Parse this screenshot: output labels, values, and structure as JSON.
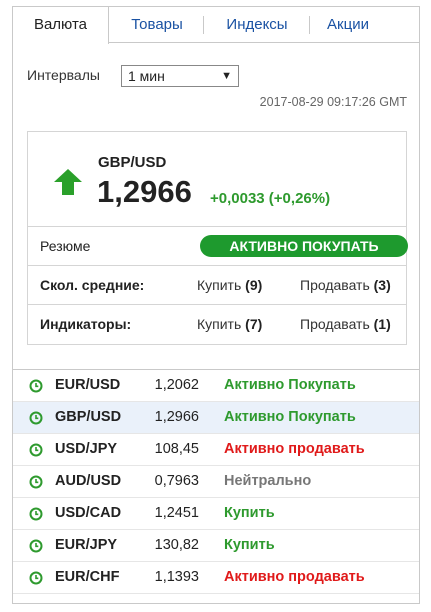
{
  "tabs": [
    {
      "label": "Валюта",
      "active": true
    },
    {
      "label": "Товары",
      "active": false
    },
    {
      "label": "Индексы",
      "active": false
    },
    {
      "label": "Акции",
      "active": false
    }
  ],
  "interval": {
    "label": "Интервалы",
    "selected": "1 мин"
  },
  "timestamp": "2017-08-29 09:17:26 GMT",
  "summary": {
    "pair": "GBP/USD",
    "price": "1,2966",
    "change": "+0,0033 (+0,26%)",
    "trend_icon": "up-arrow-icon",
    "resume_label": "Резюме",
    "resume_signal": "АКТИВНО ПОКУПАТЬ",
    "ma_label": "Скол. средние:",
    "ma_buy_label": "Купить",
    "ma_buy_count": "(9)",
    "ma_sell_label": "Продавать",
    "ma_sell_count": "(3)",
    "ind_label": "Индикаторы:",
    "ind_buy_label": "Купить",
    "ind_buy_count": "(7)",
    "ind_sell_label": "Продавать",
    "ind_sell_count": "(1)"
  },
  "pairs": [
    {
      "symbol": "EUR/USD",
      "value": "1,2062",
      "signal": "Активно Покупать",
      "kind": "buy",
      "selected": false
    },
    {
      "symbol": "GBP/USD",
      "value": "1,2966",
      "signal": "Активно Покупать",
      "kind": "buy",
      "selected": true
    },
    {
      "symbol": "USD/JPY",
      "value": "108,45",
      "signal": "Активно продавать",
      "kind": "sell",
      "selected": false
    },
    {
      "symbol": "AUD/USD",
      "value": "0,7963",
      "signal": "Нейтрально",
      "kind": "neutral",
      "selected": false
    },
    {
      "symbol": "USD/CAD",
      "value": "1,2451",
      "signal": "Купить",
      "kind": "buy",
      "selected": false
    },
    {
      "symbol": "EUR/JPY",
      "value": "130,82",
      "signal": "Купить",
      "kind": "buy",
      "selected": false
    },
    {
      "symbol": "EUR/CHF",
      "value": "1,1393",
      "signal": "Активно продавать",
      "kind": "sell",
      "selected": false
    }
  ],
  "colors": {
    "buy": "#2e9a2e",
    "sell": "#e01a1a",
    "neutral": "#777777",
    "link": "#1a52a3",
    "badge": "#1e9a2e"
  }
}
